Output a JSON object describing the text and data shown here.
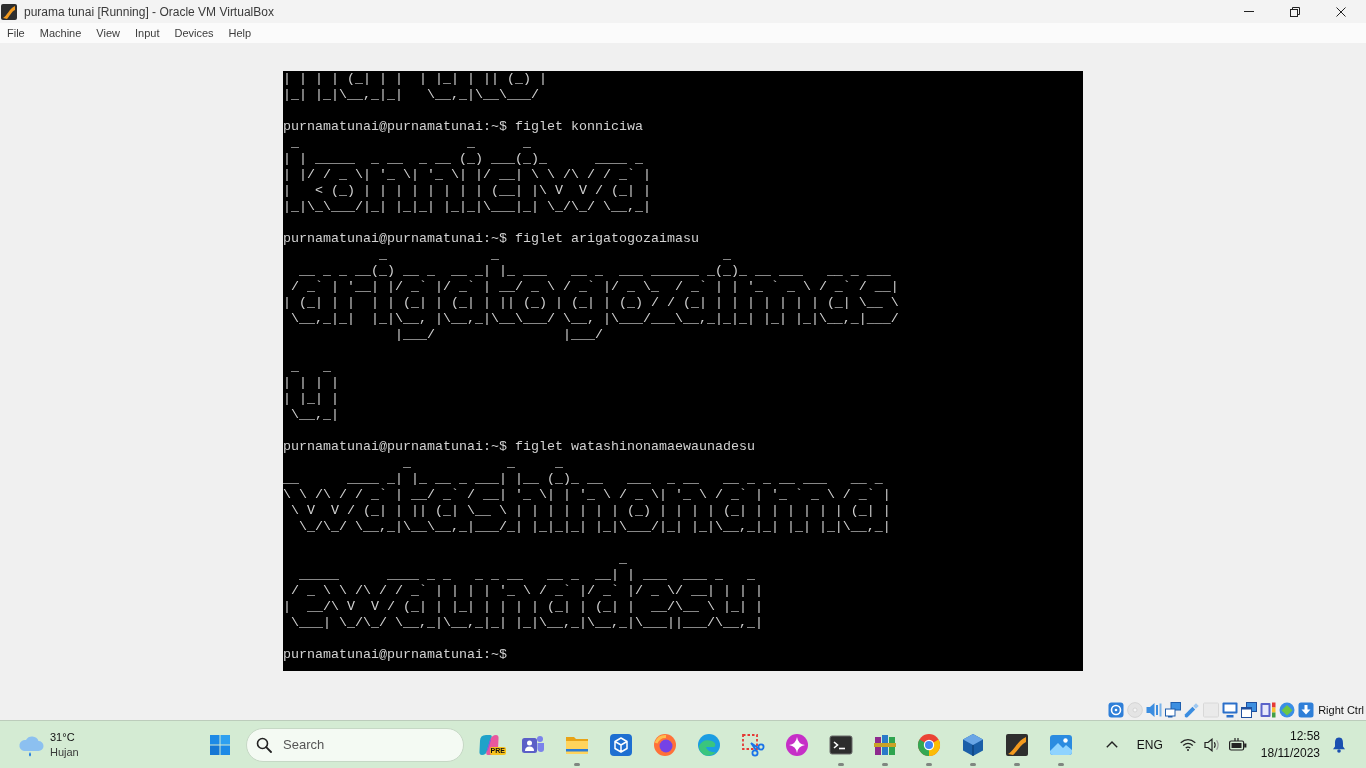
{
  "window": {
    "title": "purama tunai [Running] - Oracle VM VirtualBox"
  },
  "menu": [
    "File",
    "Machine",
    "View",
    "Input",
    "Devices",
    "Help"
  ],
  "terminal": {
    "entries": [
      {
        "kind": "output",
        "text": "| | | | (_| | |  | |_| | || (_) |\n|_| |_|\\__,_|_|   \\__,_|\\__\\___/\n"
      },
      {
        "kind": "prompt",
        "prompt": "purnamatunai@purnamatunai:~$",
        "command": "figlet konniciwa"
      },
      {
        "kind": "output",
        "text": " _                     _      _\n| | _____  _ __  _ __ (_) ___(_)_      ____ _\n| |/ / _ \\| '_ \\| '_ \\| |/ __| \\ \\ /\\ / / _` |\n|   < (_) | | | | | | | | (__| |\\ V  V / (_| |\n|_|\\_\\___/|_| |_|_| |_|_|\\___|_| \\_/\\_/ \\__,_|\n"
      },
      {
        "kind": "prompt",
        "prompt": "purnamatunai@purnamatunai:~$",
        "command": "figlet arigatogozaimasu"
      },
      {
        "kind": "output",
        "text": "            _             _                            _\n  __ _ _ __(_) __ _  __ _| |_ ___   __ _  ___ ______ _(_)_ __ ___   __ _ ___\n / _` | '__| |/ _` |/ _` | __/ _ \\ / _` |/ _ \\_  / _` | | '_ ` _ \\ / _` / __|\n| (_| | |  | | (_| | (_| | || (_) | (_| | (_) / / (_| | | | | | | | (_| \\__ \\\n \\__,_|_|  |_|\\__, |\\__,_|\\__\\___/ \\__, |\\___/___\\__,_|_|_| |_| |_|\\__,_|___/\n              |___/                |___/\n\n _   _\n| | | |\n| |_| |\n \\__,_|\n"
      },
      {
        "kind": "prompt",
        "prompt": "purnamatunai@purnamatunai:~$",
        "command": "figlet watashinonamaewaunadesu"
      },
      {
        "kind": "output",
        "text": "               _            _     _\n__      ____ _| |_ __ _ ___| |__ (_)_ __   ___  _ __   __ _ _ __ ___   __ _\n\\ \\ /\\ / / _` | __/ _` / __| '_ \\| | '_ \\ / _ \\| '_ \\ / _` | '_ ` _ \\ / _` |\n \\ V  V / (_| | || (_| \\__ \\ | | | | | | | (_) | | | | (_| | | | | | | (_| |\n  \\_/\\_/ \\__,_|\\__\\__,_|___/_| |_|_|_| |_|\\___/|_| |_|\\__,_|_| |_| |_|\\__,_|\n\n                                          _\n  _____      ____ _ _   _ _ __   __ _  __| | ___  ___ _   _\n / _ \\ \\ /\\ / / _` | | | | '_ \\ / _` |/ _` |/ _ \\/ __| | | |\n|  __/\\ V  V / (_| | |_| | | | | (_| | (_| |  __/\\__ \\ |_| |\n \\___| \\_/\\_/ \\__,_|\\__,_|_| |_|\\__,_|\\__,_|\\___||___/\\__,_|\n"
      },
      {
        "kind": "prompt",
        "prompt": "purnamatunai@purnamatunai:~$"
      }
    ]
  },
  "status_bar": {
    "indicators": [
      {
        "kind": "hard_disk",
        "enabled": true
      },
      {
        "kind": "optical",
        "enabled": false
      },
      {
        "kind": "audio",
        "enabled": true
      },
      {
        "kind": "network",
        "enabled": true
      },
      {
        "kind": "usb",
        "enabled": true
      },
      {
        "kind": "shared_folders",
        "enabled": false
      },
      {
        "kind": "display",
        "enabled": true
      },
      {
        "kind": "recording",
        "enabled": true
      },
      {
        "kind": "cpu",
        "enabled": true
      },
      {
        "kind": "mouse",
        "enabled": true
      },
      {
        "kind": "keyboard",
        "enabled": true
      }
    ],
    "host_key": "Right Ctrl"
  },
  "taskbar": {
    "weather": {
      "temperature": "31°C",
      "condition": "Hujan"
    },
    "search": {
      "placeholder": "Search"
    },
    "apps": [
      {
        "kind": "blob",
        "badge": "PRE",
        "running": false
      },
      {
        "kind": "people",
        "running": false
      },
      {
        "kind": "folder",
        "running": true
      },
      {
        "kind": "cube_tile",
        "running": false
      },
      {
        "kind": "swirl",
        "running": false
      },
      {
        "kind": "wave",
        "running": false
      },
      {
        "kind": "scissors",
        "running": false
      },
      {
        "kind": "sparkle",
        "running": false
      },
      {
        "kind": "terminal",
        "running": true
      },
      {
        "kind": "books",
        "running": true
      },
      {
        "kind": "ring",
        "running": true
      },
      {
        "kind": "cube",
        "running": true
      },
      {
        "kind": "swoosh",
        "running": true
      },
      {
        "kind": "landscape",
        "running": true
      }
    ],
    "tray": {
      "language": "ENG",
      "time": "12:58",
      "date": "18/11/2023"
    }
  }
}
